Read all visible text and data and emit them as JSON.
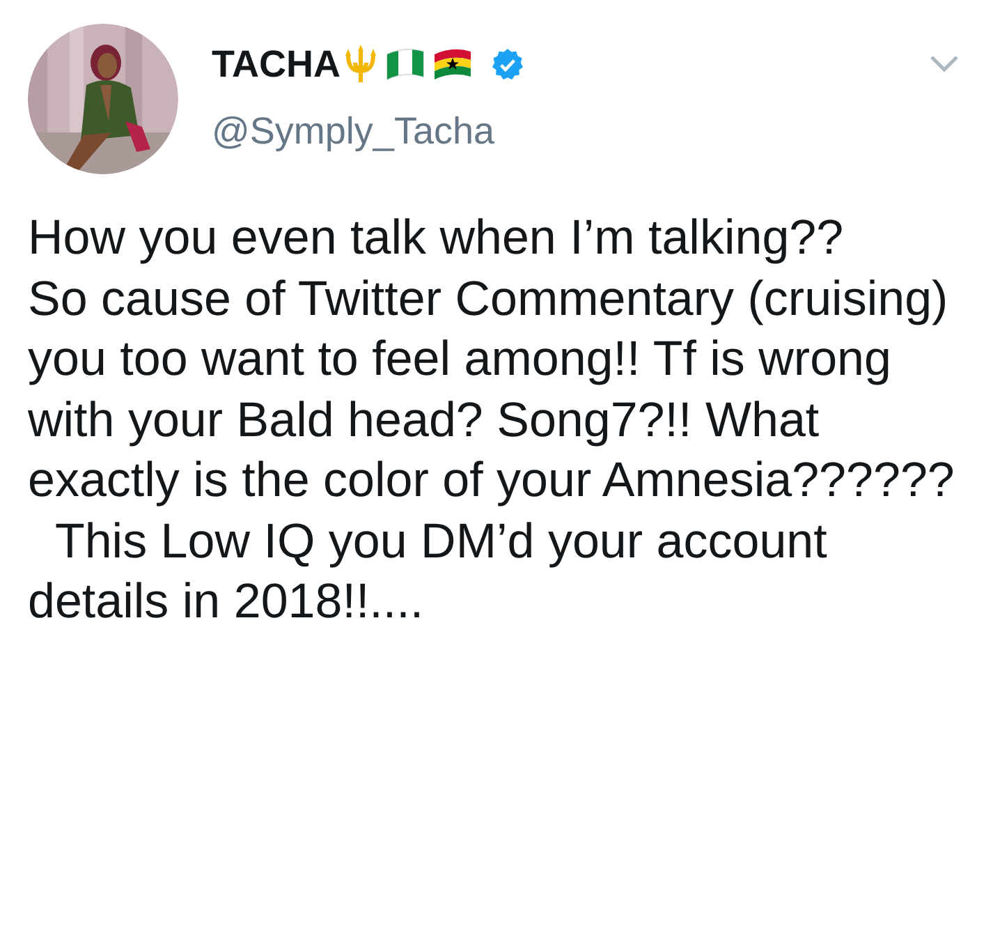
{
  "tweet": {
    "display_name": "TACHA",
    "handle": "@Symply_Tacha",
    "verified": true,
    "text": "How you even talk when I’m talking??\nSo cause of Twitter Commentary (cruising) you too want to feel among!! Tf is wrong with your Bald head? Song7?!! What exactly is the color of your Amnesia??????\n  This Low IQ you DM’d your account details in 2018!!...."
  }
}
